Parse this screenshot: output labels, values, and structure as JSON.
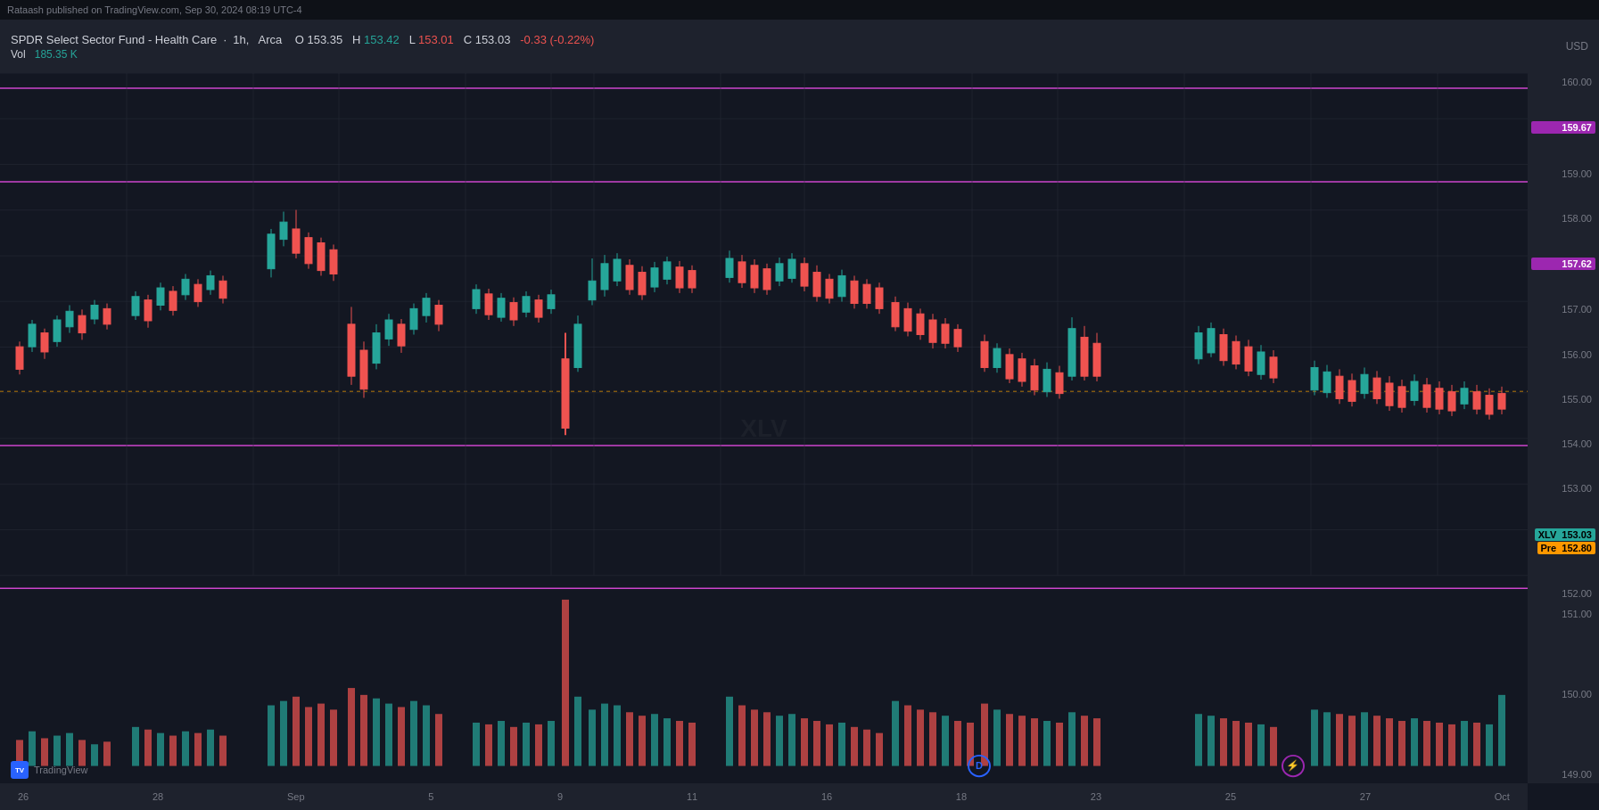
{
  "published_bar": {
    "text": "Rataash published on TradingView.com, Sep 30, 2024 08:19 UTC-4"
  },
  "symbol": {
    "name": "SPDR Select Sector Fund - Health Care",
    "timeframe": "1h",
    "exchange": "Arca",
    "open_label": "O",
    "open_val": "153.35",
    "high_label": "H",
    "high_val": "153.42",
    "low_label": "L",
    "low_val": "153.01",
    "close_label": "C",
    "close_val": "153.03",
    "change_val": "-0.33",
    "change_pct": "(-0.22%)",
    "currency": "USD",
    "vol_label": "Vol",
    "vol_val": "185.35 K"
  },
  "price_levels": {
    "line1": {
      "price": "159.67",
      "type": "purple"
    },
    "line2": {
      "price": "157.62",
      "type": "purple"
    },
    "line3": {
      "price": "151.85",
      "type": "purple"
    },
    "xlv_price": "153.03",
    "pre_price": "152.80"
  },
  "y_axis": {
    "labels": [
      "160.00",
      "159.00",
      "158.00",
      "157.00",
      "156.00",
      "155.00",
      "154.00",
      "153.00",
      "152.00",
      "151.00",
      "150.00",
      "149.00"
    ]
  },
  "time_axis": {
    "labels": [
      "26",
      "28",
      "Sep",
      "5",
      "9",
      "11",
      "16",
      "18",
      "23",
      "25",
      "27",
      "Oct"
    ]
  },
  "icons": {
    "tradingview": "TV"
  },
  "volume_panel": {
    "label": "Vol"
  }
}
